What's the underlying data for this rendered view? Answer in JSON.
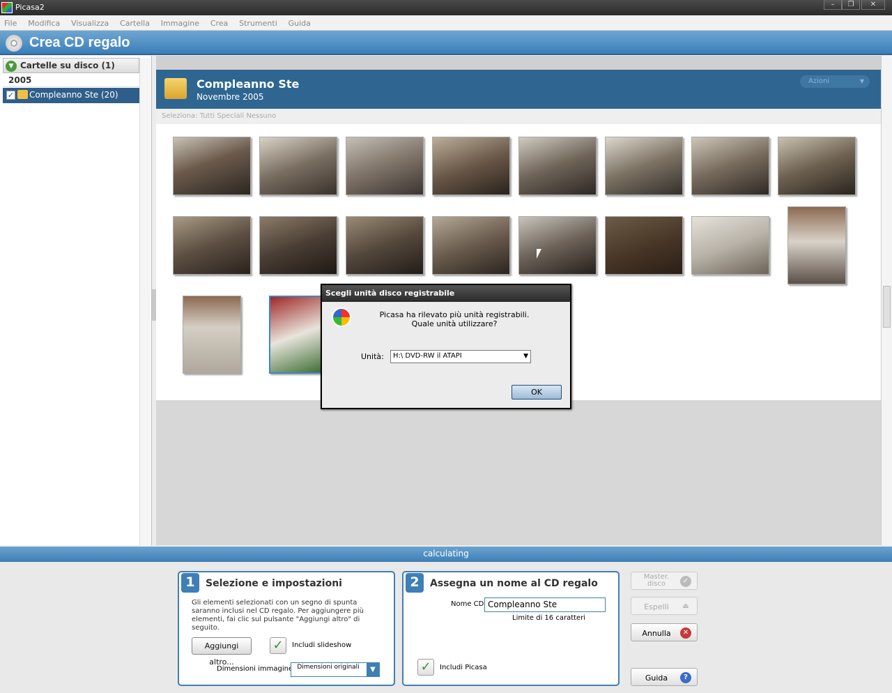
{
  "window": {
    "title": "Picasa2"
  },
  "menu": [
    "File",
    "Modifica",
    "Visualizza",
    "Cartella",
    "Immagine",
    "Crea",
    "Strumenti",
    "Guida"
  ],
  "banner": {
    "title": "Crea CD regalo"
  },
  "left_panel": {
    "header": "Cartelle su disco (1)",
    "year": "2005",
    "folder": "Compleanno Ste (20)"
  },
  "folder_header": {
    "name": "Compleanno Ste",
    "date": "Novembre 2005",
    "actions": "Azioni"
  },
  "select_bar": {
    "label": "Seleziona:",
    "all": "Tutti",
    "special": "Speciali",
    "none": "Nessuno"
  },
  "status": "calculating",
  "step1": {
    "number": "1",
    "title": "Selezione e impostazioni",
    "description": "Gli elementi selezionati con un segno di spunta saranno inclusi nel CD regalo. Per aggiungere più elementi, fai clic sul pulsante \"Aggiungi altro\" di seguito.",
    "add_button": "Aggiungi altro...",
    "include_slideshow": "Includi slideshow",
    "image_size_label": "Dimensioni immagine",
    "image_size_value": "Dimensioni originali"
  },
  "step2": {
    "number": "2",
    "title": "Assegna un nome al CD regalo",
    "cd_name_label": "Nome CD",
    "cd_name_value": "Compleanno Ste",
    "limit": "Limite di 16 caratteri",
    "include_picasa": "Includi Picasa"
  },
  "side_buttons": {
    "master": "Master. disco",
    "eject": "Espelli",
    "cancel": "Annulla",
    "help": "Guida"
  },
  "dialog": {
    "title": "Scegli unità disco registrabile",
    "message1": "Picasa ha rilevato più unità registrabili.",
    "message2": "Quale unità utilizzare?",
    "drive_label": "Unità:",
    "drive_value": "H:\\ DVD-RW il ATAPI",
    "ok": "OK"
  },
  "colors": {
    "accent": "#3e7fb5",
    "folder_bar": "#2e6691",
    "selected": "#2f5e8a"
  }
}
